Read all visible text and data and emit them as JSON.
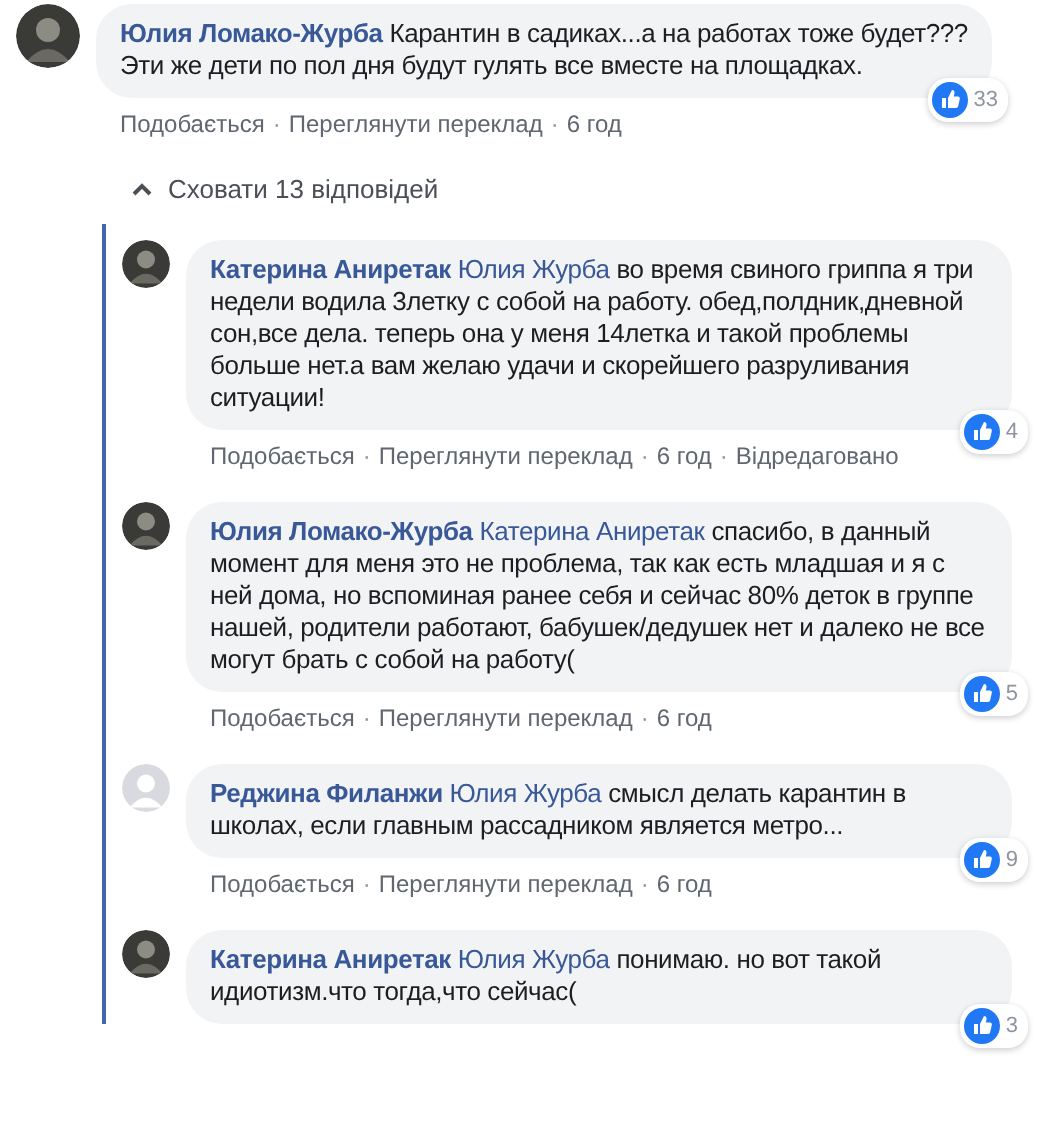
{
  "separator": "·",
  "comment": {
    "author": "Юлия Ломако-Журба",
    "has_photo": true,
    "text": "Карантин в садиках...а на работах тоже будет???\nЭти же дети по пол дня будут гулять все вместе на площадках.",
    "reactions": "33",
    "actions": [
      "Подобається",
      "Переглянути переклад",
      "6 год"
    ]
  },
  "toggle_replies": {
    "label": "Сховати 13 відповідей",
    "expanded": true
  },
  "replies": [
    {
      "author": "Катерина Аниретак",
      "has_photo": true,
      "mention": "Юлия Журба",
      "text": "во время свиного гриппа я три недели водила 3летку с собой на работу. обед,полдник,дневной сон,все дела. теперь она у меня 14летка и такой проблемы больше нет.а вам желаю удачи и скорейшего разруливания ситуации!",
      "reactions": "4",
      "actions": [
        "Подобається",
        "Переглянути переклад",
        "6 год",
        "Відредаговано"
      ]
    },
    {
      "author": "Юлия Ломако-Журба",
      "has_photo": true,
      "mention": "Катерина Аниретак",
      "text": "спасибо, в данный момент для меня это не проблема, так как есть младшая и я с ней дома, но вспоминая ранее себя и сейчас 80% деток в группе нашей, родители работают, бабушек/дедушек нет и далеко не все могут брать с собой на работу(",
      "reactions": "5",
      "actions": [
        "Подобається",
        "Переглянути переклад",
        "6 год"
      ]
    },
    {
      "author": "Реджина Филанжи",
      "has_photo": false,
      "mention": "Юлия Журба",
      "text": "смысл делать карантин в школах, если главным рассадником является метро...",
      "reactions": "9",
      "actions": [
        "Подобається",
        "Переглянути переклад",
        "6 год"
      ]
    },
    {
      "author": "Катерина Аниретак",
      "has_photo": true,
      "mention": "Юлия Журба",
      "text": "понимаю. но вот такой идиотизм.что тогда,что сейчас(",
      "reactions": "3"
    }
  ]
}
